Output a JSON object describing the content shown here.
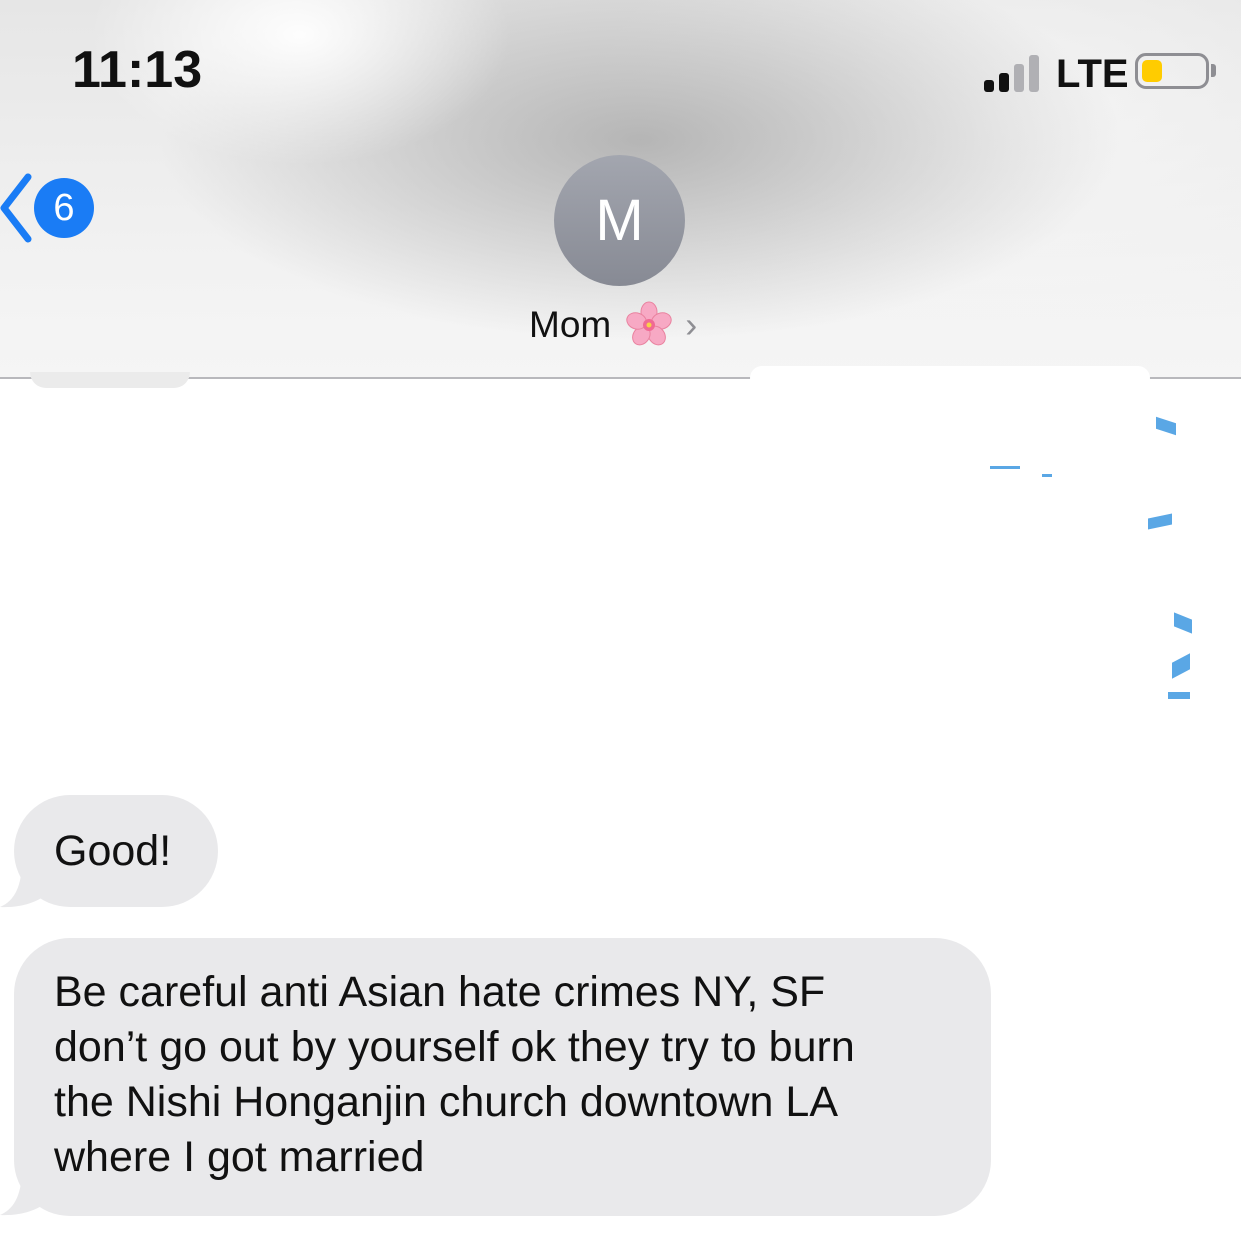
{
  "status_bar": {
    "time": "11:13",
    "network": "LTE",
    "signal_bars_filled": 2,
    "signal_bars_total": 4,
    "battery_color": "#ffcc00"
  },
  "nav": {
    "back_badge": "6",
    "avatar_initial": "M",
    "contact_name": "Mom",
    "contact_emoji": "cherry-blossom-icon",
    "chevron": "›",
    "accent": "#1a7cf5"
  },
  "messages": [
    {
      "direction": "incoming",
      "text": "Good!"
    },
    {
      "direction": "incoming",
      "text": "Be careful anti Asian hate crimes NY, SF\ndon’t go out by yourself ok they try to burn\nthe Nishi Honganjin church downtown LA\nwhere I got married"
    }
  ],
  "bubble_color": "#e9e9eb"
}
